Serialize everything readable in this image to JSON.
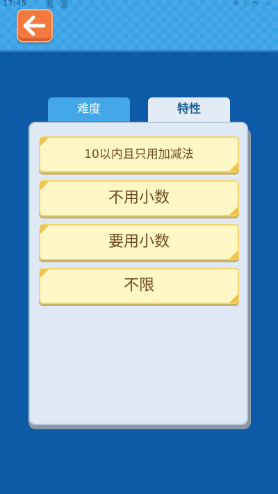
{
  "status": {
    "time": "17:45"
  },
  "tabs": [
    {
      "label": "难度",
      "active": false
    },
    {
      "label": "特性",
      "active": true
    }
  ],
  "options": [
    {
      "label": "10以内且只用加减法"
    },
    {
      "label": "不用小数"
    },
    {
      "label": "要用小数"
    },
    {
      "label": "不限"
    }
  ],
  "colors": {
    "background": "#0d5ba6",
    "header": "#3aa3e6",
    "back_button": "#f37a3f",
    "option_fill": "#fff7c5",
    "option_text": "#6b4a1f"
  },
  "icons": {
    "back": "arrow-left-icon"
  }
}
